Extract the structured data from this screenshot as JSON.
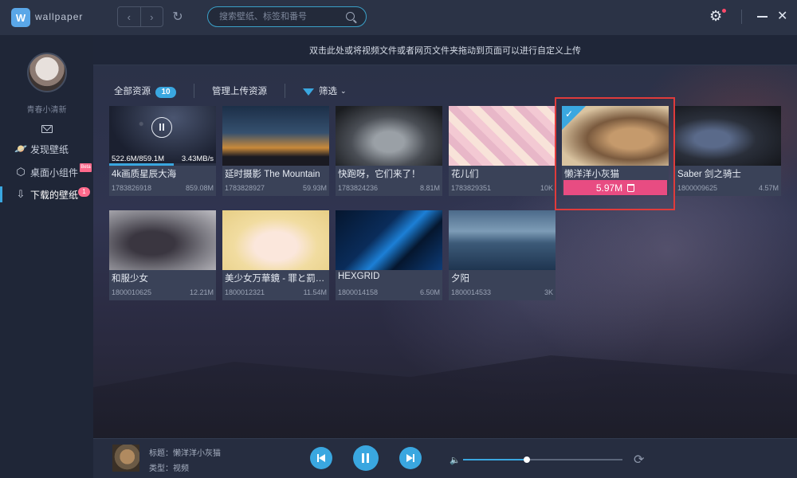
{
  "titlebar": {
    "logo_char": "W",
    "app_name": "wallpaper",
    "back_glyph": "‹",
    "forward_glyph": "›",
    "refresh_glyph": "↻",
    "search_placeholder": "搜索壁纸、标签和番号",
    "settings_glyph": "⚙",
    "close_glyph": "✕"
  },
  "sidebar": {
    "username": "青春小清新",
    "items": [
      {
        "icon": "planet-icon",
        "glyph": "🪐",
        "label": "发现壁纸"
      },
      {
        "icon": "widget-icon",
        "glyph": "⬡",
        "label": "桌面小组件",
        "badge": "Beta"
      },
      {
        "icon": "download-icon",
        "glyph": "⇩",
        "label": "下载的壁纸",
        "badge": "1"
      }
    ]
  },
  "banner": {
    "text": "双击此处或将视频文件或者网页文件夹拖动到页面可以进行自定义上传"
  },
  "toolbar": {
    "all_resources_label": "全部资源",
    "all_resources_count": "10",
    "manage_uploads_label": "管理上传资源",
    "filter_label": "筛选",
    "chevron_glyph": "⌄"
  },
  "download": {
    "info": "522.6M/859.1M",
    "speed": "3.43MB/s",
    "progress": 0.608
  },
  "cards": [
    {
      "title": "4k画质星辰大海",
      "id": "1783826918",
      "size": "859.08M",
      "thumb": "starry-sky"
    },
    {
      "title": "延时摄影 The Mountain",
      "id": "1783828927",
      "size": "59.93M",
      "thumb": "timelapse-mountain"
    },
    {
      "title": "快跑呀，它们来了！",
      "id": "1783824236",
      "size": "8.81M",
      "thumb": "zombies"
    },
    {
      "title": "花儿们",
      "id": "1783829351",
      "size": "10K",
      "thumb": "anime-girls"
    },
    {
      "title": "懒洋洋小灰猫",
      "id": "",
      "size": "5.97M",
      "thumb": "grey-cat",
      "selected": true
    },
    {
      "title": "Saber 剑之骑士",
      "id": "1800009625",
      "size": "4.57M",
      "thumb": "saber"
    },
    {
      "title": "和服少女",
      "id": "1800010625",
      "size": "12.21M",
      "thumb": "kimono-girl"
    },
    {
      "title": "美少女万華鏡 - 罪と罰の少女",
      "id": "1800012321",
      "size": "11.54M",
      "thumb": "blonde-girl"
    },
    {
      "title": "HEXGRID",
      "id": "1800014158",
      "size": "6.50M",
      "thumb": "hexgrid"
    },
    {
      "title": "夕阳",
      "id": "1800014533",
      "size": "3K",
      "thumb": "sunset-sea"
    }
  ],
  "selected_card": {
    "check_glyph": "✓",
    "size_pill": "5.97M"
  },
  "player": {
    "title_line": "标题：懒洋洋小灰猫",
    "type_line": "类型：视频",
    "volume_glyph": "🔈",
    "volume": 0.4,
    "loop_glyph": "⟳"
  },
  "colors": {
    "accent": "#3aa7e0",
    "pink": "#e84c82",
    "selection": "#e03b3b"
  }
}
